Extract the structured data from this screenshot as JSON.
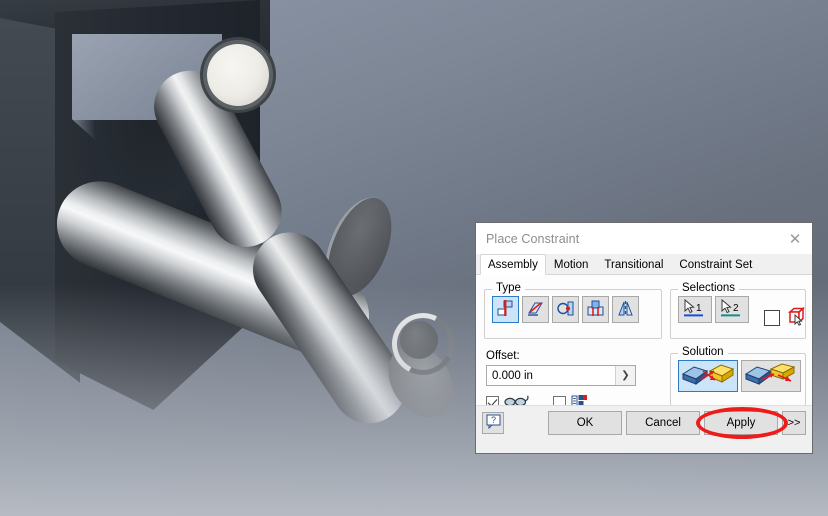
{
  "viewport": {
    "name": "cad-3d-viewport",
    "description": "3D assembly view of metallic rods and dark fixture block",
    "background_top_color": "#8e97a8",
    "background_bottom_color": "#bdc1c7",
    "block_color": "#262b31",
    "metal_highlight_color": "#f7f8f8"
  },
  "dialog": {
    "title": "Place Constraint",
    "close_label": "✕",
    "tabs": [
      {
        "label": "Assembly",
        "active": true
      },
      {
        "label": "Motion",
        "active": false
      },
      {
        "label": "Transitional",
        "active": false
      },
      {
        "label": "Constraint Set",
        "active": false
      }
    ],
    "type_group": {
      "legend": "Type",
      "buttons": [
        {
          "icon": "mate-constraint-icon",
          "selected": true
        },
        {
          "icon": "angle-constraint-icon",
          "selected": false
        },
        {
          "icon": "tangent-constraint-icon",
          "selected": false
        },
        {
          "icon": "insert-constraint-icon",
          "selected": false
        },
        {
          "icon": "symmetry-constraint-icon",
          "selected": false
        }
      ]
    },
    "selections_group": {
      "legend": "Selections",
      "buttons": [
        {
          "icon": "select-cursor-icon",
          "label": "1",
          "underline_color": "#1c4fd8"
        },
        {
          "icon": "select-cursor-icon",
          "label": "2",
          "underline_color": "#0f8f8f"
        }
      ],
      "pick_part_first_checked": false,
      "pick_part_first_icon": "pick-part-first-cube-icon"
    },
    "offset": {
      "label": "Offset:",
      "value": "0.000 in",
      "placeholder": "0.000 in",
      "dropdown_icon": "chevron-right-icon"
    },
    "options": [
      {
        "icon": "show-preview-glasses-icon",
        "checked": true
      },
      {
        "icon": "predict-offset-icon",
        "checked": false
      }
    ],
    "solution_group": {
      "legend": "Solution",
      "buttons": [
        {
          "icon": "solution-opposed-icon",
          "selected": true
        },
        {
          "icon": "solution-aligned-icon",
          "selected": false
        }
      ]
    },
    "footer": {
      "help_label": "?",
      "help_icon": "help-question-icon",
      "ok_label": "OK",
      "cancel_label": "Cancel",
      "apply_label": "Apply",
      "more_label": ">>",
      "annotation_color": "#ee1b1b",
      "annotated_button": "Apply"
    }
  }
}
